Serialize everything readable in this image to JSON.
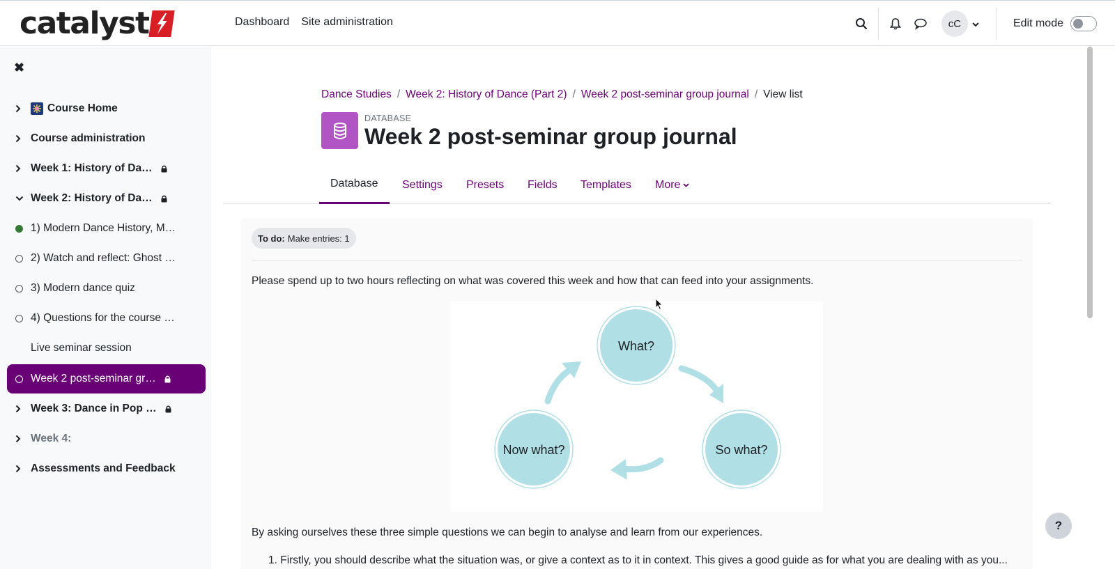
{
  "brand": {
    "name": "catalyst",
    "accent": "#d81f26"
  },
  "topnav": {
    "dashboard": "Dashboard",
    "site_admin": "Site administration"
  },
  "user": {
    "initials": "cC"
  },
  "edit_mode": {
    "label": "Edit mode",
    "enabled": false
  },
  "sidebar": {
    "items": [
      {
        "label": "Course Home",
        "icon": "fireworks-icon",
        "type": "section"
      },
      {
        "label": "Course administration",
        "type": "section"
      },
      {
        "label": "Week 1: History of Da…",
        "type": "section",
        "locked": true
      },
      {
        "label": "Week 2: History of Da…",
        "type": "section",
        "locked": true,
        "expanded": true
      },
      {
        "label": "1) Modern Dance History, M…",
        "type": "activity",
        "status": "complete"
      },
      {
        "label": "2) Watch and reflect: Ghost …",
        "type": "activity",
        "status": "incomplete"
      },
      {
        "label": "3) Modern dance quiz",
        "type": "activity",
        "status": "incomplete"
      },
      {
        "label": "4) Questions for the course …",
        "type": "activity",
        "status": "incomplete"
      },
      {
        "label": "Live seminar session",
        "type": "activity"
      },
      {
        "label": "Week 2 post-seminar gr…",
        "type": "activity",
        "status": "incomplete",
        "locked": true,
        "active": true
      },
      {
        "label": "Week 3: Dance in Pop …",
        "type": "section",
        "locked": true
      },
      {
        "label": "Week 4:",
        "type": "section"
      },
      {
        "label": "Assessments and Feedback",
        "type": "section"
      }
    ]
  },
  "breadcrumb": {
    "c1": "Dance Studies",
    "c2": "Week 2: History of Dance (Part 2)",
    "c3": "Week 2 post-seminar group journal",
    "current": "View list"
  },
  "activity": {
    "type": "DATABASE",
    "title": "Week 2 post-seminar group journal",
    "icon_color": "#b155c4"
  },
  "tabs": {
    "t1": "Database",
    "t2": "Settings",
    "t3": "Presets",
    "t4": "Fields",
    "t5": "Templates",
    "t6": "More"
  },
  "todo": {
    "label": "To do:",
    "text": "Make entries: 1"
  },
  "content": {
    "intro": "Please spend up to two hours reflecting on what was covered this week and how that can feed into your assignments.",
    "diagram": {
      "q1": "What?",
      "q2": "So what?",
      "q3": "Now what?",
      "color": "#b0dfe5"
    },
    "after": "By asking ourselves these three simple questions we can begin to analyse and learn from our experiences.",
    "list_item_1": "1.  Firstly, you should describe what the situation was, or give a context as to it in context. This gives a good guide as for what you are dealing with as you..."
  },
  "help": {
    "label": "?"
  }
}
